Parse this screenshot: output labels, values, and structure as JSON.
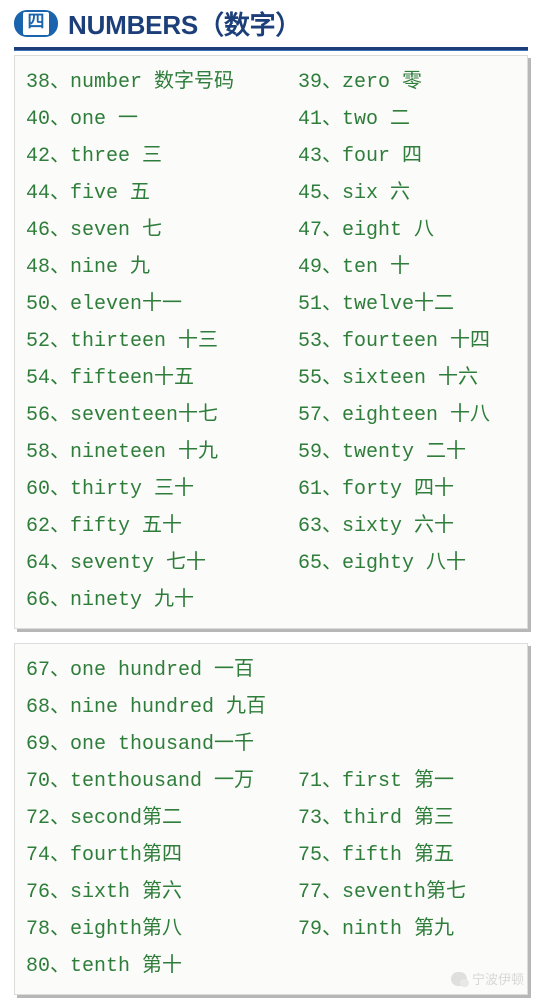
{
  "header": {
    "badge_icon": "section-number-badge",
    "badge_char": "四",
    "title": "NUMBERS（数字）",
    "title_color": "#1c3f7a",
    "rule_color": "#1c3f7a"
  },
  "theme": {
    "entry_color": "#2e7d3a",
    "card_background": "#fbfbf9",
    "card_border": "#dcdcd8",
    "card_shadow": "#b7b7b7",
    "page_background": "#ffffff"
  },
  "cards": [
    {
      "name": "numbers-cardinal-card",
      "rows": [
        {
          "left": "38、number 数字号码",
          "right": "39、zero 零"
        },
        {
          "left": "40、one 一",
          "right": "41、two 二"
        },
        {
          "left": "42、three 三",
          "right": "43、four 四"
        },
        {
          "left": "44、five 五",
          "right": "45、six 六"
        },
        {
          "left": "46、seven 七",
          "right": "47、eight 八"
        },
        {
          "left": "48、nine 九",
          "right": "49、ten 十"
        },
        {
          "left": "50、eleven十一",
          "right": "51、twelve十二"
        },
        {
          "left": "52、thirteen 十三",
          "right": "53、fourteen 十四"
        },
        {
          "left": "54、fifteen十五",
          "right": "55、sixteen 十六"
        },
        {
          "left": "56、seventeen十七",
          "right": "57、eighteen 十八"
        },
        {
          "left": "58、nineteen 十九",
          "right": "59、twenty 二十"
        },
        {
          "left": "60、thirty 三十",
          "right": "61、forty 四十"
        },
        {
          "left": "62、fifty 五十",
          "right": "63、sixty 六十"
        },
        {
          "left": "64、seventy 七十",
          "right": "65、eighty 八十"
        },
        {
          "left": "66、ninety 九十",
          "right": ""
        }
      ]
    },
    {
      "name": "numbers-large-and-ordinal-card",
      "rows": [
        {
          "left": "67、one hundred 一百",
          "right": ""
        },
        {
          "left": "68、nine hundred 九百",
          "right": ""
        },
        {
          "left": "69、one thousand一千",
          "right": ""
        },
        {
          "left": "70、tenthousand 一万",
          "right": "71、first 第一"
        },
        {
          "left": "72、second第二",
          "right": "73、third 第三"
        },
        {
          "left": "74、fourth第四",
          "right": "75、fifth 第五"
        },
        {
          "left": "76、sixth 第六",
          "right": "77、seventh第七"
        },
        {
          "left": "78、eighth第八",
          "right": "79、ninth 第九"
        },
        {
          "left": "80、tenth 第十",
          "right": ""
        }
      ]
    }
  ],
  "watermark": {
    "icon": "wechat-logo-icon",
    "text": "宁波伊顿"
  }
}
